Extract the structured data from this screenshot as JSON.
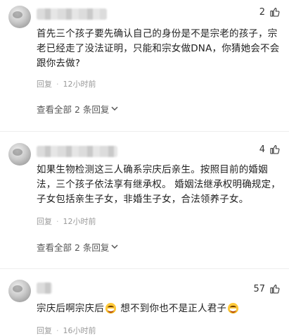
{
  "comments": [
    {
      "likes": "2",
      "text": "首先三个孩子要先确认自己的身份是不是宗老的孩子，宗老已经走了没法证明，只能和宗女做DNA，你猜她会不会跟你去做?",
      "reply_label": "回复",
      "separator": "·",
      "time": "12小时前",
      "view_replies": "查看全部 2 条回复"
    },
    {
      "likes": "4",
      "text": "如果生物检测这三人确系宗庆后亲生。按照目前的婚姻法，三个孩子依法享有继承权。 婚姻法继承权明确规定，子女包括亲生子女，非婚生子女，合法领养子女。",
      "reply_label": "回复",
      "separator": "·",
      "time": "12小时前",
      "view_replies": "查看全部 2 条回复"
    },
    {
      "likes": "57",
      "text_part1": "宗庆后啊宗庆后",
      "text_part2": " 想不到你也不是正人君子",
      "reply_label": "回复",
      "separator": "·",
      "time": "16小时前"
    }
  ],
  "icons": {
    "like": "thumbs-up-icon",
    "expand": "chevron-down-icon",
    "emoji": "grinning-face-emoji"
  }
}
